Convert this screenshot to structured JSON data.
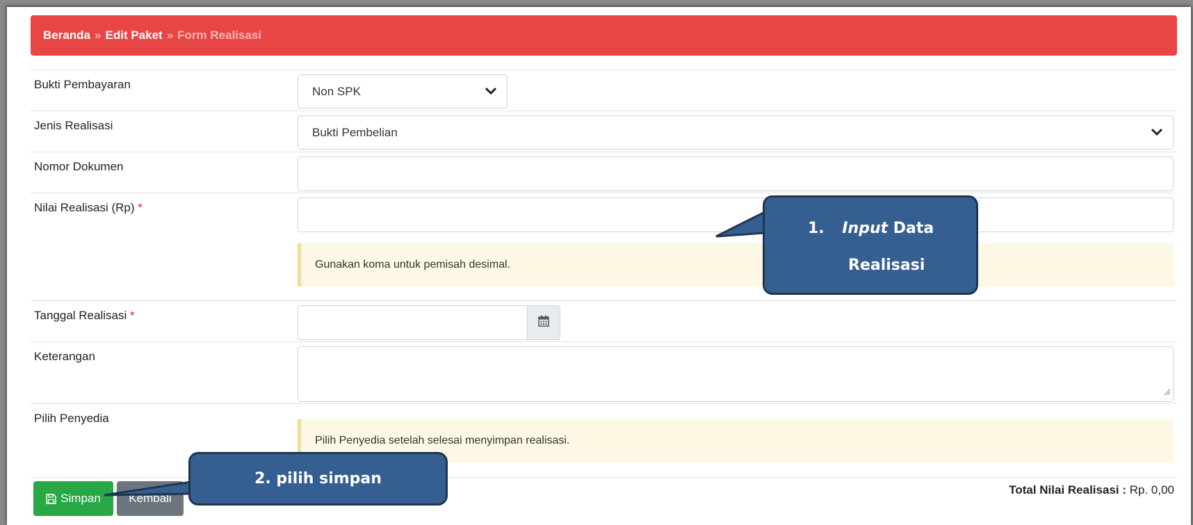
{
  "breadcrumb": {
    "home": "Beranda",
    "separator": "»",
    "edit": "Edit Paket",
    "current": "Form Realisasi"
  },
  "form": {
    "bukti_pembayaran": {
      "label": "Bukti Pembayaran",
      "value": "Non SPK"
    },
    "jenis_realisasi": {
      "label": "Jenis Realisasi",
      "value": "Bukti Pembelian"
    },
    "nomor_dokumen": {
      "label": "Nomor Dokumen",
      "value": ""
    },
    "nilai_realisasi": {
      "label": "Nilai Realisasi (Rp)",
      "required_mark": "*",
      "value": "",
      "hint": "Gunakan koma untuk pemisah desimal."
    },
    "tanggal_realisasi": {
      "label": "Tanggal Realisasi",
      "required_mark": "*",
      "value": ""
    },
    "keterangan": {
      "label": "Keterangan",
      "value": ""
    },
    "pilih_penyedia": {
      "label": "Pilih Penyedia",
      "hint": "Pilih Penyedia setelah selesai menyimpan realisasi."
    }
  },
  "actions": {
    "save_label": "Simpan",
    "back_label": "Kembali"
  },
  "total": {
    "label": "Total Nilai Realisasi :",
    "value": "Rp. 0,00"
  },
  "callouts": {
    "first_number": "1.",
    "first_italic": "Input",
    "first_rest": "Data",
    "first_line2": "Realisasi",
    "second": "2. pilih simpan"
  },
  "icons": {
    "select_arrow": "chevron-down-icon",
    "calendar": "calendar-icon",
    "save": "floppy-disk-icon",
    "resize": "resize-handle-icon"
  },
  "colors": {
    "breadcrumb_bg": "#e84545",
    "save_button": "#28a745",
    "back_button": "#6c757d",
    "callout_bg": "#365f91",
    "alert_bg": "#fcf8e3"
  }
}
